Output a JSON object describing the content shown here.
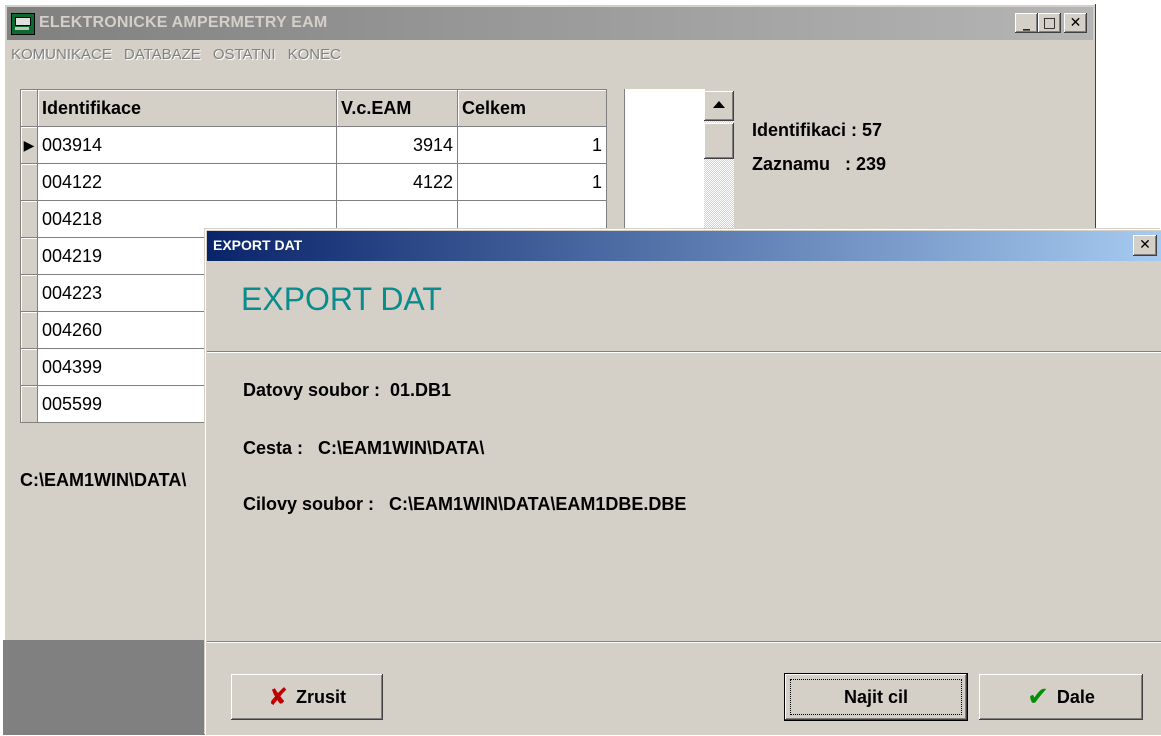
{
  "main_window": {
    "title": "ELEKTRONICKE AMPERMETRY EAM",
    "menu": [
      "KOMUNIKACE",
      "DATABAZE",
      "OSTATNI",
      "KONEC"
    ]
  },
  "grid": {
    "columns": [
      "Identifikace",
      "V.c.EAM",
      "Celkem"
    ],
    "rows": [
      {
        "id": "003914",
        "vc": "3914",
        "celkem": "1"
      },
      {
        "id": "004122",
        "vc": "4122",
        "celkem": "1"
      },
      {
        "id": "004218",
        "vc": "",
        "celkem": ""
      },
      {
        "id": "004219",
        "vc": "",
        "celkem": ""
      },
      {
        "id": "004223",
        "vc": "",
        "celkem": ""
      },
      {
        "id": "004260",
        "vc": "",
        "celkem": ""
      },
      {
        "id": "004399",
        "vc": "",
        "celkem": ""
      },
      {
        "id": "005599",
        "vc": "",
        "celkem": ""
      }
    ]
  },
  "stats": {
    "identifikaci": "Identifikaci : 57",
    "zaznamu": "Zaznamu   : 239"
  },
  "path_label": "C:\\EAM1WIN\\DATA\\",
  "dialog": {
    "title": "EXPORT DAT",
    "heading": "EXPORT DAT",
    "datovy_soubor": "Datovy soubor :  01.DB1",
    "cesta": "Cesta :   C:\\EAM1WIN\\DATA\\",
    "cilovy_soubor": "Cilovy soubor :   C:\\EAM1WIN\\DATA\\EAM1DBE.DBE",
    "buttons": {
      "zrusit": "Zrusit",
      "najit": "Najit cil",
      "dale": "Dale"
    }
  }
}
